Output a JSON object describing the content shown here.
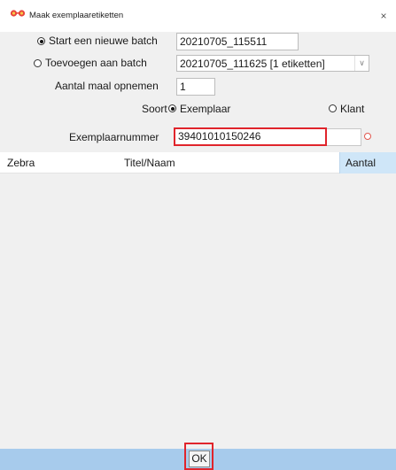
{
  "window": {
    "title": "Maak exemplaaretiketten",
    "close_glyph": "×",
    "app_icon": "glasses-icon"
  },
  "form": {
    "new_batch": {
      "label": "Start een nieuwe batch",
      "checked": true,
      "value": "20210705_115511"
    },
    "add_to_batch": {
      "label": "Toevoegen aan batch",
      "checked": false,
      "selected": "20210705_111625 [1 etiketten]"
    },
    "quantity": {
      "label": "Aantal maal opnemen",
      "value": "1"
    },
    "type": {
      "label": "Soort",
      "options": [
        {
          "label": "Exemplaar",
          "checked": true
        },
        {
          "label": "Klant",
          "checked": false
        }
      ]
    },
    "item_number": {
      "label": "Exemplaarnummer",
      "value": "39401010150246"
    }
  },
  "table": {
    "columns": [
      "Zebra",
      "Titel/Naam",
      "Aantal"
    ],
    "rows": []
  },
  "footer": {
    "ok_label": "OK"
  },
  "colors": {
    "highlight": "#e0242b",
    "bottom_bar": "#a7cbec",
    "selected_header": "#cfe6f8"
  }
}
